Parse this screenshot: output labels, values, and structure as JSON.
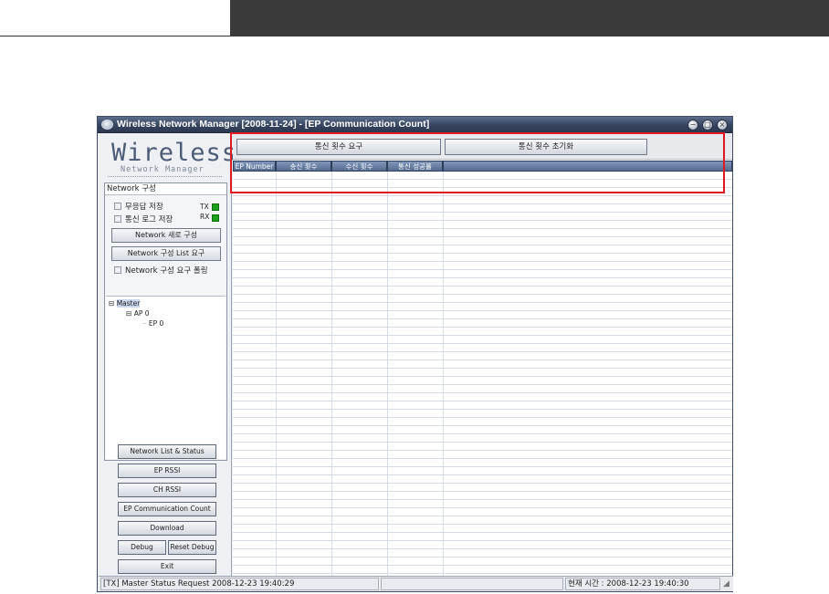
{
  "window": {
    "title": "Wireless Network Manager [2008-11-24] - [EP Communication Count]",
    "controls": [
      "minimize",
      "maximize",
      "close"
    ],
    "minimize_glyph": "−",
    "maximize_glyph": "□",
    "close_glyph": "×"
  },
  "logo": {
    "main": "Wireless",
    "sub": "Network Manager"
  },
  "network_group": {
    "title": "Network 구성",
    "checkbox_no_response": "무응답 저장",
    "checkbox_comm_log": "통신 로그 저장",
    "tx_label": "TX",
    "rx_label": "RX",
    "btn_new_config": "Network 새로 구성",
    "btn_config_list": "Network 구성 List 요구",
    "checkbox_polling": "Network 구성 요구 폴링",
    "tree": [
      {
        "label": "Master",
        "toggle": "⊟",
        "level": 0
      },
      {
        "label": "AP 0",
        "toggle": "⊟",
        "level": 1
      },
      {
        "label": "EP 0",
        "toggle": "",
        "level": 2
      }
    ]
  },
  "toolbar": {
    "request_label": "통신 횟수 요구",
    "reset_label": "통신 횟수 초기화"
  },
  "grid": {
    "columns": [
      "EP Number",
      "송신 횟수",
      "수신 횟수",
      "통신 성공률"
    ],
    "rows": []
  },
  "nav": {
    "buttons": [
      "Network List & Status",
      "EP RSSI",
      "CH RSSI",
      "EP Communication Count",
      "Download",
      "Debug",
      "Reset Debug",
      "Exit"
    ]
  },
  "status": {
    "message": "[TX] Master  Status Request 2008-12-23 19:40:29",
    "middle": "",
    "clock": "현재 시간 : 2008-12-23 19:40:30"
  },
  "colors": {
    "highlight": "#e0181f",
    "led_on": "#1aa31a",
    "title_bar": "#36445f"
  }
}
